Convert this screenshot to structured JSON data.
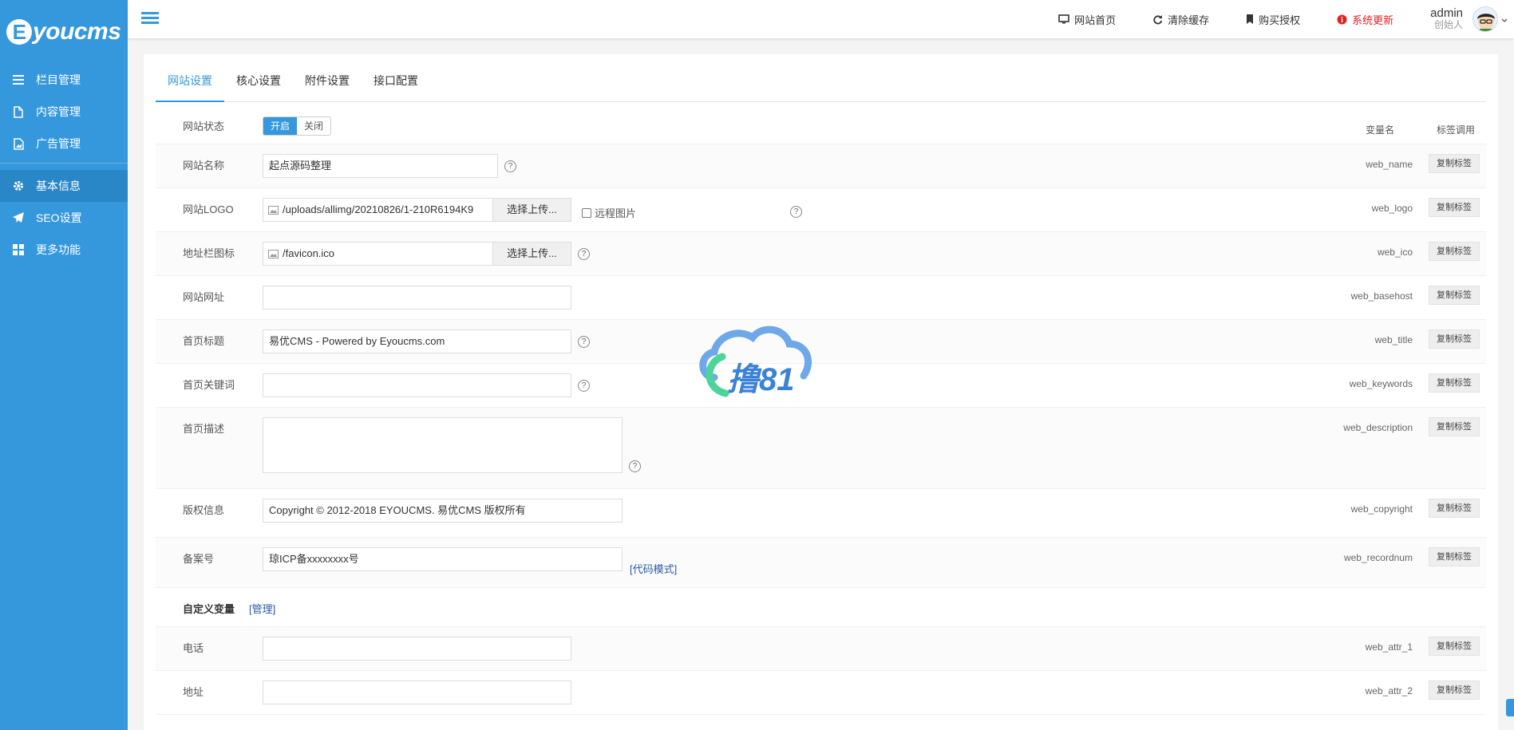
{
  "app": {
    "logo_text": "youcms",
    "logo_letter": "E"
  },
  "sidebar": {
    "items": [
      {
        "label": "栏目管理",
        "icon": "list-icon"
      },
      {
        "label": "内容管理",
        "icon": "file-icon"
      },
      {
        "label": "广告管理",
        "icon": "image-icon"
      },
      {
        "label": "基本信息",
        "icon": "gear-icon",
        "active": true
      },
      {
        "label": "SEO设置",
        "icon": "paper-plane-icon"
      },
      {
        "label": "更多功能",
        "icon": "grid-icon"
      }
    ]
  },
  "topbar": {
    "links": [
      {
        "label": "网站首页",
        "icon": "monitor-icon"
      },
      {
        "label": "清除缓存",
        "icon": "refresh-icon"
      },
      {
        "label": "购买授权",
        "icon": "bookmark-icon"
      },
      {
        "label": "系统更新",
        "icon": "info-icon"
      }
    ],
    "user": {
      "name": "admin",
      "role": "创始人"
    }
  },
  "tabs": [
    {
      "label": "网站设置",
      "active": true
    },
    {
      "label": "核心设置"
    },
    {
      "label": "附件设置"
    },
    {
      "label": "接口配置"
    }
  ],
  "headers": {
    "var_name": "变量名",
    "tag_call": "标签调用"
  },
  "copy_label": "复制标签",
  "form": {
    "status": {
      "label": "网站状态",
      "on": "开启",
      "off": "关闭"
    },
    "name": {
      "label": "网站名称",
      "value": "起点源码整理",
      "var": "web_name"
    },
    "logo": {
      "label": "网站LOGO",
      "value": "/uploads/allimg/20210826/1-210R6194K9",
      "button": "选择上传...",
      "remote": "远程图片",
      "var": "web_logo"
    },
    "ico": {
      "label": "地址栏图标",
      "value": "/favicon.ico",
      "button": "选择上传...",
      "var": "web_ico"
    },
    "basehost": {
      "label": "网站网址",
      "value": "",
      "var": "web_basehost"
    },
    "title": {
      "label": "首页标题",
      "value": "易优CMS -  Powered by Eyoucms.com",
      "var": "web_title"
    },
    "keywords": {
      "label": "首页关键词",
      "value": "",
      "var": "web_keywords"
    },
    "description": {
      "label": "首页描述",
      "value": "",
      "var": "web_description"
    },
    "copyright": {
      "label": "版权信息",
      "value": "Copyright © 2012-2018 EYOUCMS. 易优CMS 版权所有",
      "var": "web_copyright"
    },
    "recordnum": {
      "label": "备案号",
      "value": "琼ICP备xxxxxxxx号",
      "code_mode": "[代码模式]",
      "var": "web_recordnum"
    },
    "custom": {
      "label": "自定义变量",
      "manage": "[管理]"
    },
    "attr1": {
      "label": "电话",
      "value": "",
      "var": "web_attr_1"
    },
    "attr2": {
      "label": "地址",
      "value": "",
      "var": "web_attr_2"
    }
  },
  "watermark": {
    "text": "撸81"
  },
  "colors": {
    "primary": "#3598dc",
    "update": "#e02222",
    "link": "#2a5ba8"
  }
}
